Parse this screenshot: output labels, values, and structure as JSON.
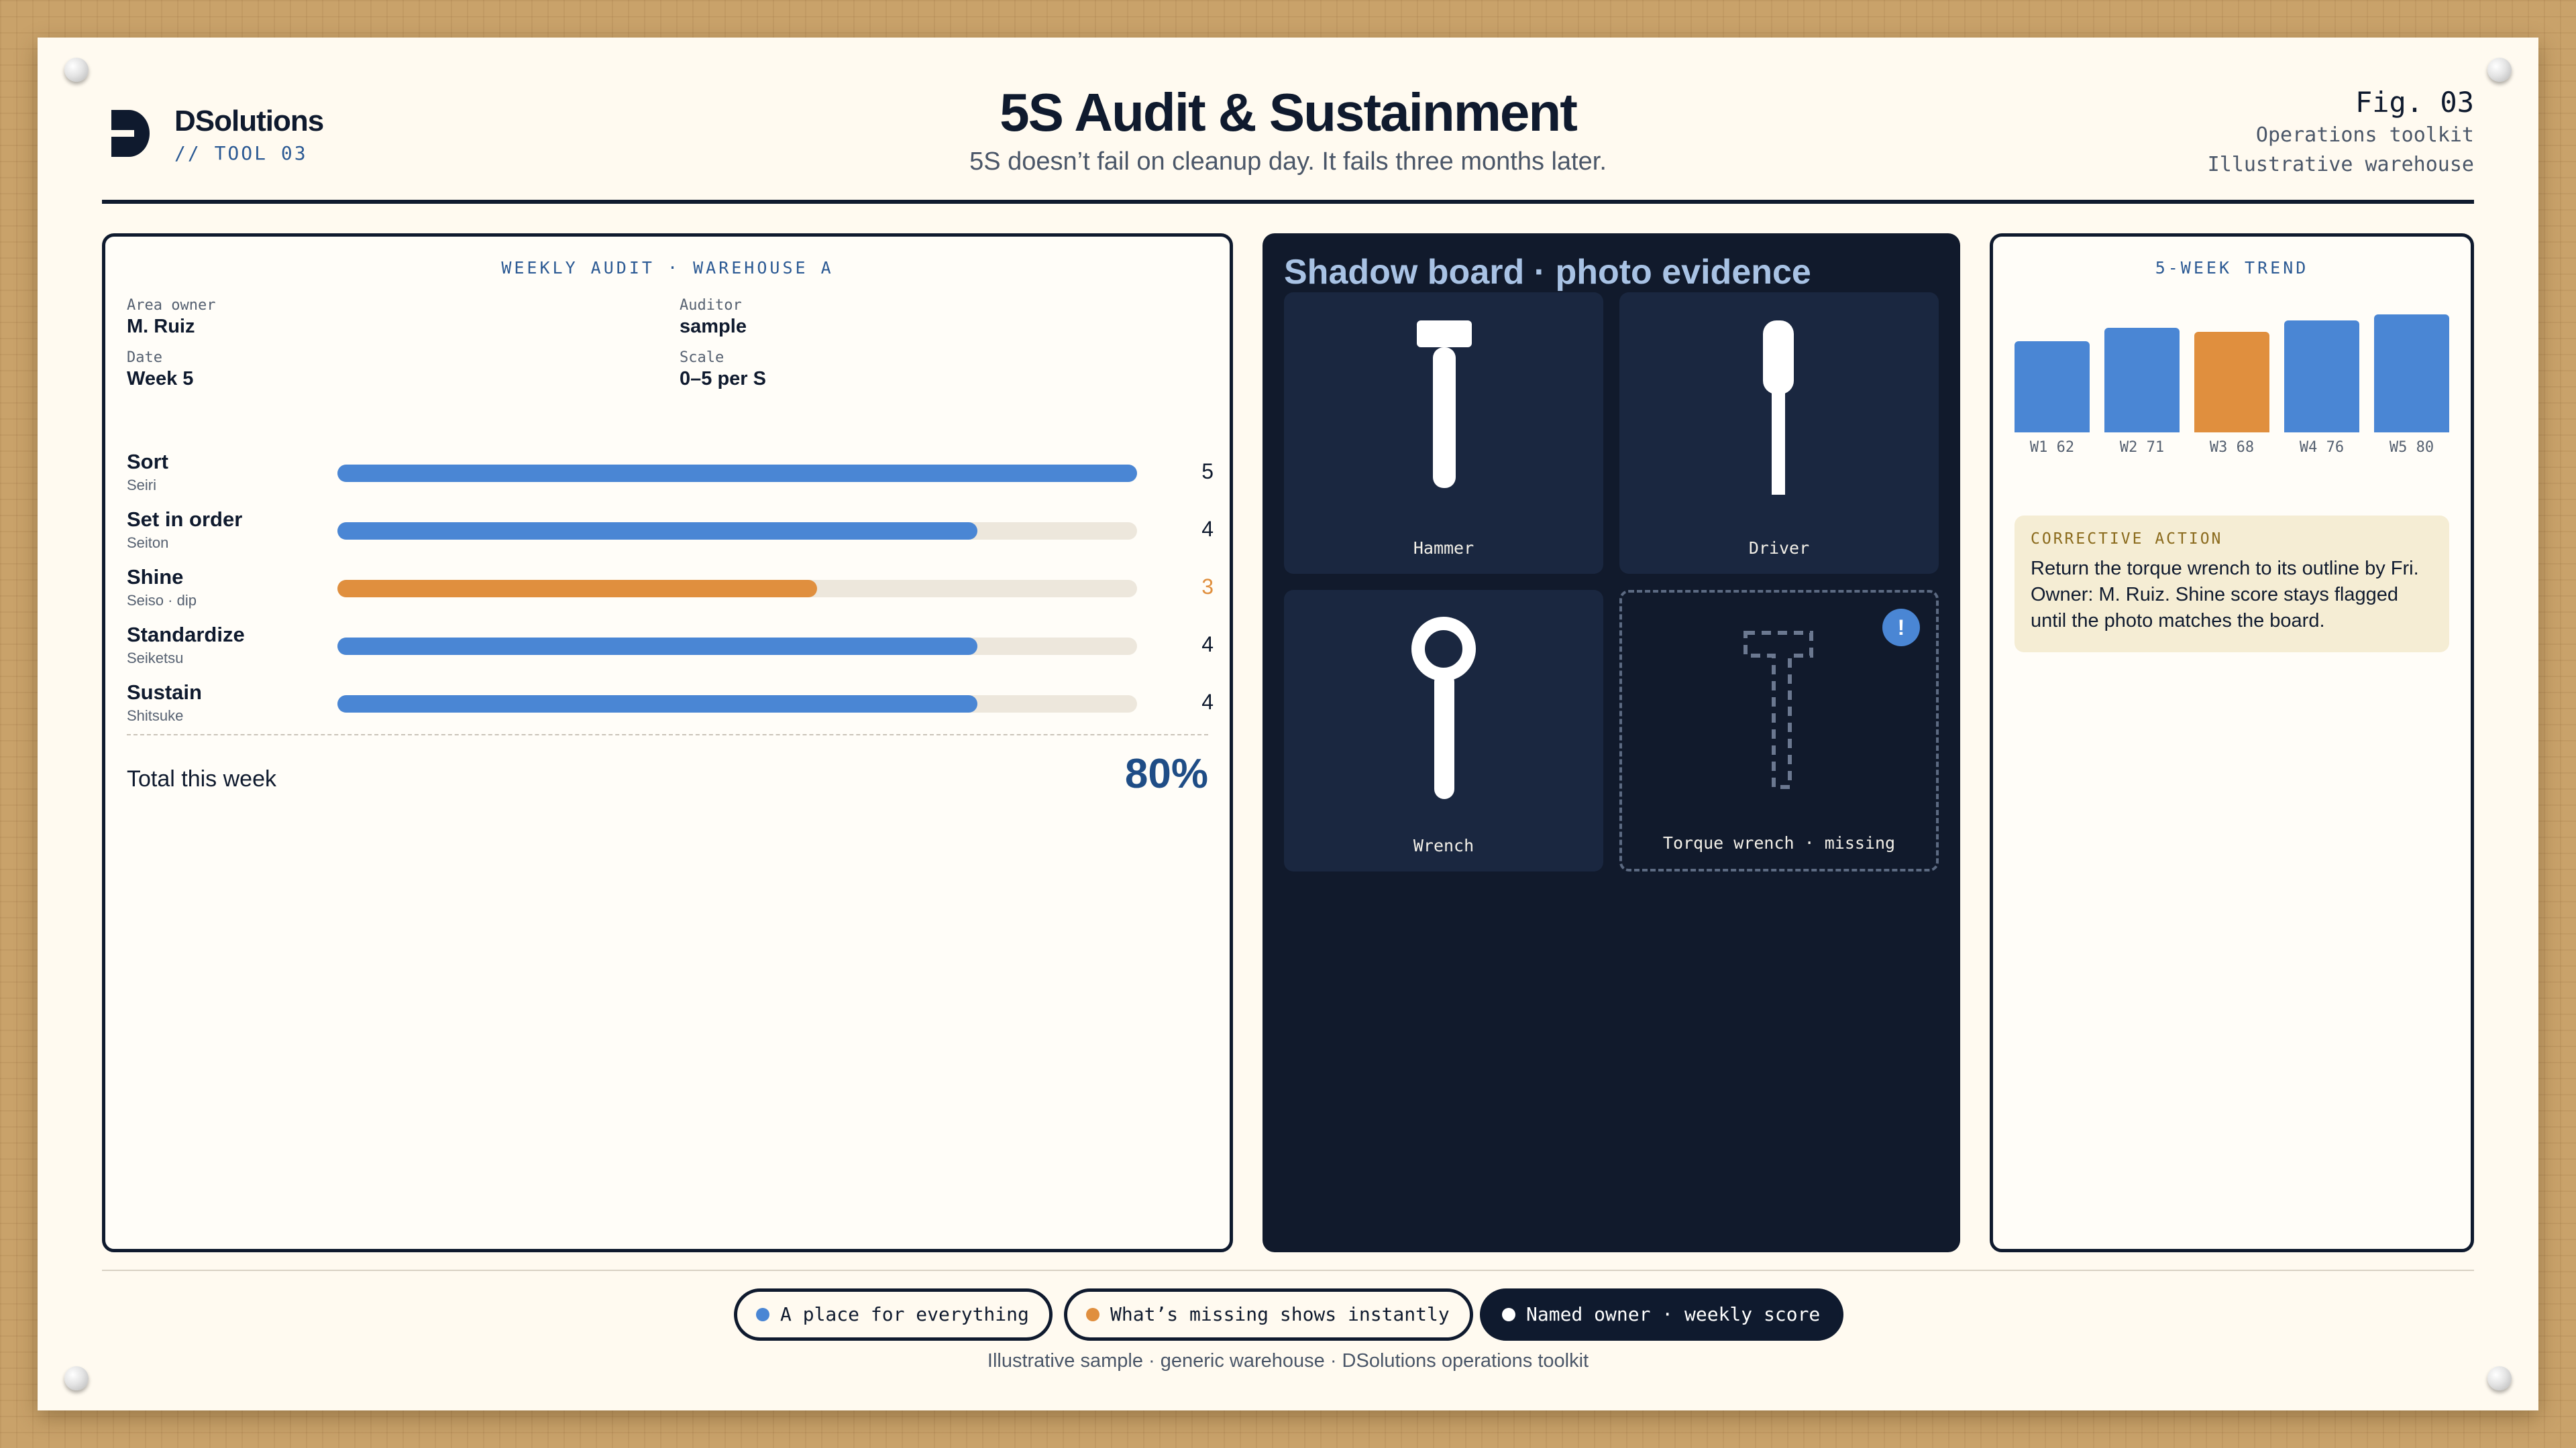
{
  "colors": {
    "accent": "#4a86d4",
    "warning": "#e08f3e",
    "ink": "#0f1a2e",
    "board": "#111a2c"
  },
  "header": {
    "brand": "DSolutions",
    "brand_sub": "// TOOL 03",
    "title": "5S Audit & Sustainment",
    "subtitle": "5S doesn’t fail on cleanup day. It fails three months later.",
    "fig": "Fig. 03",
    "fig_sub_1": "Operations toolkit",
    "fig_sub_2": "Illustrative warehouse",
    "logo_icon": "d-logo-icon"
  },
  "audit": {
    "title": "WEEKLY AUDIT · WAREHOUSE A",
    "meta": [
      {
        "label": "Area owner",
        "value": "M. Ruiz"
      },
      {
        "label": "Auditor",
        "value": "sample"
      },
      {
        "label": "Date",
        "value": "Week 5"
      },
      {
        "label": "Scale",
        "value": "0–5 per S"
      }
    ],
    "criteria": [
      {
        "name": "Sort",
        "sub": "Seiri",
        "score": "5",
        "value": 5,
        "max": 5,
        "color": "#4a86d4"
      },
      {
        "name": "Set in order",
        "sub": "Seiton",
        "score": "4",
        "value": 4,
        "max": 5,
        "color": "#4a86d4"
      },
      {
        "name": "Shine",
        "sub": "Seiso · dip",
        "score": "3",
        "value": 3,
        "max": 5,
        "color": "#e08f3e"
      },
      {
        "name": "Standardize",
        "sub": "Seiketsu",
        "score": "4",
        "value": 4,
        "max": 5,
        "color": "#4a86d4"
      },
      {
        "name": "Sustain",
        "sub": "Shitsuke",
        "score": "4",
        "value": 4,
        "max": 5,
        "color": "#4a86d4"
      }
    ],
    "total_label": "Total this week",
    "total_value": "80%"
  },
  "shadow_board": {
    "title": "Shadow board · photo evidence",
    "tools": [
      {
        "label": "Hammer",
        "icon": "hammer-icon"
      },
      {
        "label": "Driver",
        "icon": "screwdriver-icon"
      },
      {
        "label": "Wrench",
        "icon": "wrench-icon"
      },
      {
        "label": "Torque wrench · missing",
        "icon": "torque-wrench-outline-icon",
        "alert": "!"
      }
    ]
  },
  "trend": {
    "title": "5-WEEK TREND",
    "chart_data": {
      "type": "bar",
      "categories": [
        "W1",
        "W2",
        "W3",
        "W4",
        "W5"
      ],
      "values": [
        62,
        71,
        68,
        76,
        80
      ],
      "labels": [
        "W1 62",
        "W2 71",
        "W3 68",
        "W4 76",
        "W5 80"
      ],
      "colors": [
        "#4a86d4",
        "#4a86d4",
        "#e08f3e",
        "#4a86d4",
        "#4a86d4"
      ],
      "ylim": [
        0,
        80
      ]
    },
    "action_title": "CORRECTIVE ACTION",
    "action_text": "Return the torque wrench to its outline by Fri. Owner: M. Ruiz. Shine score stays flagged until the photo matches the board."
  },
  "footer": {
    "chips": [
      {
        "label": "A place for everything",
        "dot": "#4a86d4"
      },
      {
        "label": "What’s missing shows instantly",
        "dot": "#e08f3e"
      },
      {
        "label": "Named owner · weekly score",
        "dot": "#ffffff"
      }
    ],
    "caption": "Illustrative sample · generic warehouse · DSolutions operations toolkit"
  }
}
